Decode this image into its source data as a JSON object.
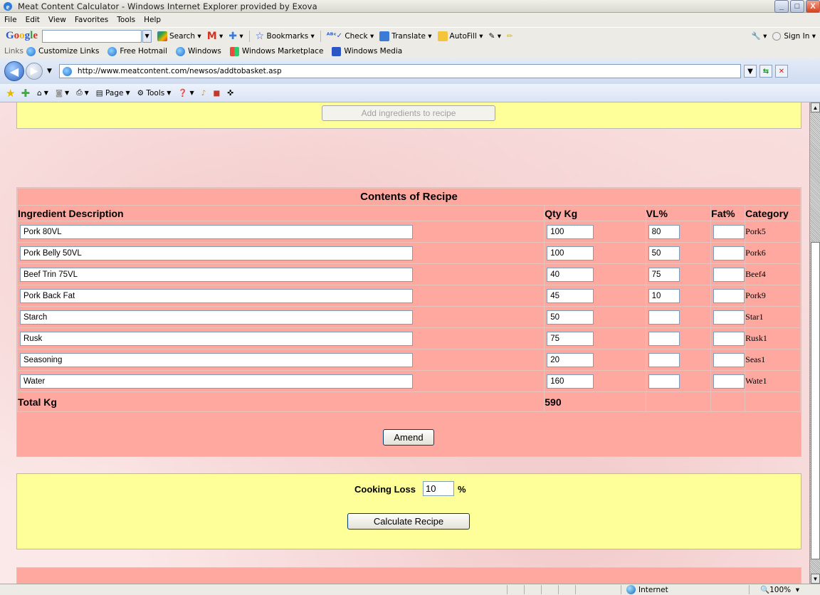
{
  "window": {
    "title": "Meat Content Calculator - Windows Internet Explorer provided by Exova",
    "min": "_",
    "max": "□",
    "close": "X"
  },
  "menu": [
    "File",
    "Edit",
    "View",
    "Favorites",
    "Tools",
    "Help"
  ],
  "google_toolbar": {
    "search_value": "",
    "items": [
      "Search",
      "Bookmarks",
      "Check",
      "Translate",
      "AutoFill"
    ],
    "sign_in": "Sign In"
  },
  "links_bar": {
    "label": "Links",
    "items": [
      "Customize Links",
      "Free Hotmail",
      "Windows",
      "Windows Marketplace",
      "Windows Media"
    ]
  },
  "address": {
    "url": "http://www.meatcontent.com/newsos/addtobasket.asp"
  },
  "command_bar": {
    "page": "Page",
    "tools": "Tools"
  },
  "page": {
    "add_button": "Add ingredients to recipe",
    "recipe": {
      "caption": "Contents of Recipe",
      "headers": {
        "description": "Ingredient Description",
        "qty": "Qty Kg",
        "vl": "VL%",
        "fat": "Fat%",
        "category": "Category"
      },
      "rows": [
        {
          "description": "Pork 80VL",
          "qty": "100",
          "vl": "80",
          "fat": "",
          "category": "Pork5"
        },
        {
          "description": "Pork Belly 50VL",
          "qty": "100",
          "vl": "50",
          "fat": "",
          "category": "Pork6"
        },
        {
          "description": "Beef Trin 75VL",
          "qty": "40",
          "vl": "75",
          "fat": "",
          "category": "Beef4"
        },
        {
          "description": "Pork Back Fat",
          "qty": "45",
          "vl": "10",
          "fat": "",
          "category": "Pork9"
        },
        {
          "description": "Starch",
          "qty": "50",
          "vl": "",
          "fat": "",
          "category": "Star1"
        },
        {
          "description": "Rusk",
          "qty": "75",
          "vl": "",
          "fat": "",
          "category": "Rusk1"
        },
        {
          "description": "Seasoning",
          "qty": "20",
          "vl": "",
          "fat": "",
          "category": "Seas1"
        },
        {
          "description": "Water",
          "qty": "160",
          "vl": "",
          "fat": "",
          "category": "Wate1"
        }
      ],
      "total_label": "Total Kg",
      "total_value": "590",
      "amend_button": "Amend"
    },
    "cooking": {
      "label": "Cooking Loss",
      "value": "10",
      "unit": "%",
      "calculate_button": "Calculate Recipe"
    }
  },
  "status": {
    "zone": "Internet",
    "zoom": "100%"
  }
}
